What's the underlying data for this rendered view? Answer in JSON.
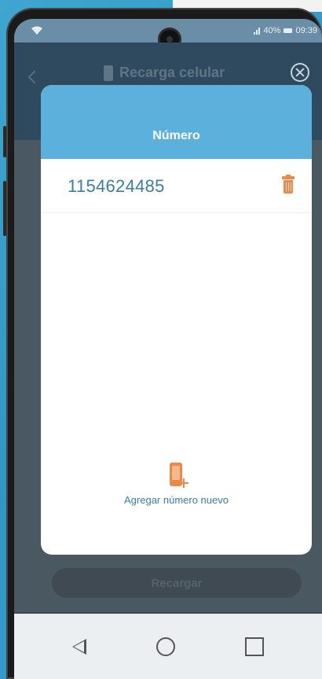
{
  "status_bar": {
    "battery_percent": "40%",
    "time": "09:39"
  },
  "app_header": {
    "title": "Recarga celular",
    "icons": [
      "back-icon",
      "phone-icon",
      "close-icon"
    ]
  },
  "modal": {
    "title": "Número",
    "numbers": [
      {
        "value": "1154624485",
        "action_icon": "trash-icon"
      }
    ],
    "add_button": {
      "label": "Agregar número nuevo",
      "icon": "add-phone-icon"
    }
  },
  "footer": {
    "recharge_label": "Recargar"
  },
  "nav_bar": {
    "icons": [
      "back-triangle-icon",
      "home-circle-icon",
      "recents-square-icon"
    ]
  },
  "colors": {
    "accent_blue": "#5cb1dc",
    "number_text": "#3b7ea3",
    "orange": "#e98a4a"
  }
}
